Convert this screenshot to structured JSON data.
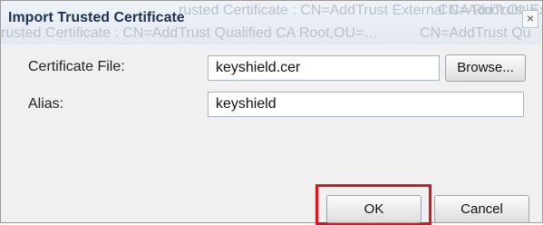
{
  "titlebar": {
    "title": "Import Trusted Certificate",
    "close_glyph": "×",
    "background_rows": [
      "rusted Certificate : CN=AddTrust External CA Root,OU=…",
      "CN=AddTrust Exte",
      "rusted Certificate : CN=AddTrust Qualified CA Root,OU=…",
      "CN=AddTrust Qu"
    ]
  },
  "form": {
    "certificate_label": "Certificate File:",
    "certificate_value": "keyshield.cer",
    "browse_label": "Browse...",
    "alias_label": "Alias:",
    "alias_value": "keyshield"
  },
  "buttons": {
    "ok_label": "OK",
    "cancel_label": "Cancel"
  },
  "colors": {
    "highlight": "#e0141e",
    "title": "#1e3350"
  }
}
